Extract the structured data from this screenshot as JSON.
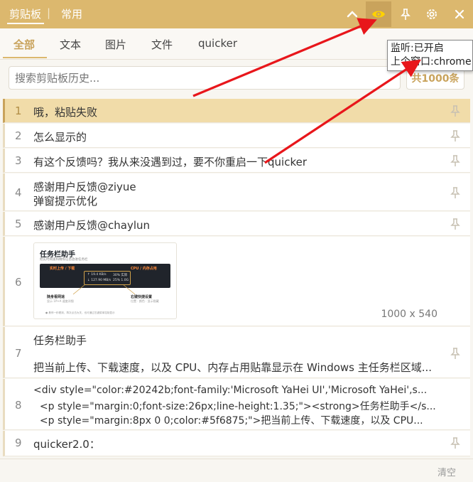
{
  "titlebar": {
    "tab_clipboard": "剪贴板",
    "separator": "|",
    "tab_common": "常用",
    "accent": "#dcb86e",
    "icons": [
      "chevron-up-icon",
      "eye-icon",
      "pin-icon",
      "gear-icon",
      "close-icon"
    ]
  },
  "tabs": [
    "全部",
    "文本",
    "图片",
    "文件",
    "quicker"
  ],
  "search": {
    "placeholder": "搜索剪贴板历史...",
    "count": "共1000条"
  },
  "items": [
    {
      "num": "1",
      "text": "哦，粘贴失败"
    },
    {
      "num": "2",
      "text": "怎么显示的"
    },
    {
      "num": "3",
      "text": "有这个反馈吗？我从来没遇到过，要不你重启一下quicker"
    },
    {
      "num": "4",
      "line1": "感谢用户反馈@ziyue",
      "line2": "弹窗提示优化"
    },
    {
      "num": "5",
      "text": "感谢用户反馈@chaylun"
    },
    {
      "num": "6",
      "dims": "1000  x  540",
      "thumb": {
        "title": "任务栏助手",
        "subtitle": "把实时网速和精炼信息放进任务栏",
        "left_label": "实时上传 / 下载",
        "right_label": "CPU / 内存占用",
        "upload": "↑ 19.4 KB/s",
        "download": "↓ 127.90 MB/s",
        "cpu": "30% 实际",
        "mem": "25% 1.0G",
        "box1_title": "随身看网速",
        "box1_desc": "显示 1P+A 速度详细",
        "box2_title": "右键快捷设置",
        "box2_desc": "位置 · 颜色 · 显示隐藏",
        "footnote": "● 悬停一秒看到，再次点击为关，也可通过右键菜单控制显示"
      }
    },
    {
      "num": "7",
      "line1": "任务栏助手",
      "line2": "把当前上传、下载速度，以及 CPU、内存占用贴靠显示在 Windows 主任务栏区域..."
    },
    {
      "num": "8",
      "line1": "<div style=\"color:#20242b;font-family:'Microsoft YaHei UI','Microsoft YaHei',s...",
      "line2": "  <p style=\"margin:0;font-size:26px;line-height:1.35;\"><strong>任务栏助手</s...",
      "line3": "  <p style=\"margin:8px 0 0;color:#5f6875;\">把当前上传、下载速度，以及 CPU..."
    },
    {
      "num": "9",
      "text": "quicker2.0："
    }
  ],
  "footer": {
    "clear": "清空"
  },
  "tooltip": {
    "line1": "监听:已开启",
    "line2": "上个窗口:chrome"
  }
}
